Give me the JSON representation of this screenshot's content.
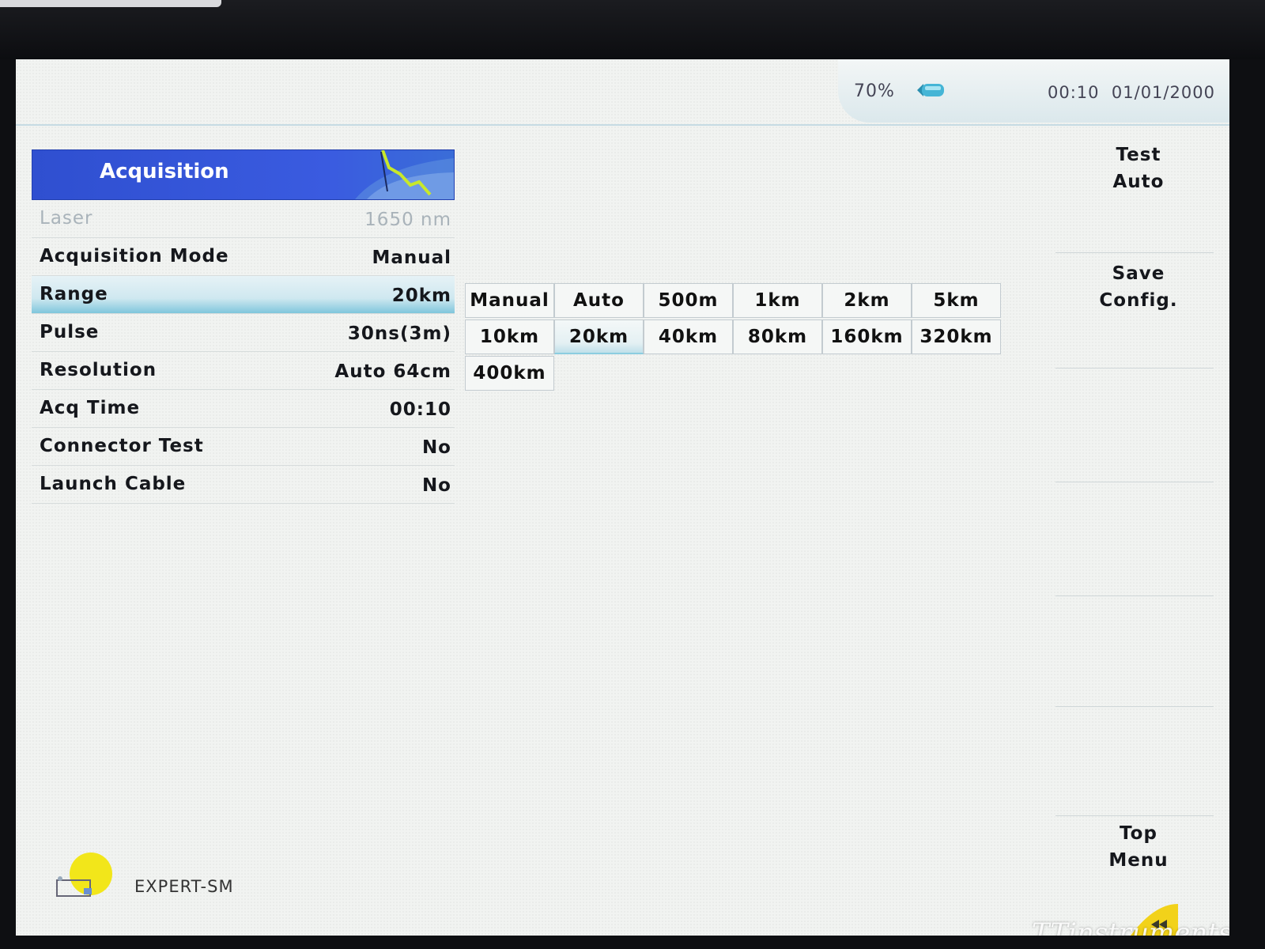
{
  "status": {
    "battery": "70%",
    "time": "00:10",
    "date": "01/01/2000"
  },
  "panel": {
    "title": "Acquisition",
    "rows": [
      {
        "label": "Laser",
        "value": "1650 nm"
      },
      {
        "label": "Acquisition Mode",
        "value": "Manual"
      },
      {
        "label": "Range",
        "value": "20km"
      },
      {
        "label": "Pulse",
        "value": "30ns(3m)"
      },
      {
        "label": "Resolution",
        "value": "Auto 64cm"
      },
      {
        "label": "Acq Time",
        "value": "00:10"
      },
      {
        "label": "Connector Test",
        "value": "No"
      },
      {
        "label": "Launch Cable",
        "value": "No"
      }
    ]
  },
  "range_options": [
    "Manual",
    "Auto",
    "500m",
    "1km",
    "2km",
    "5km",
    "10km",
    "20km",
    "40km",
    "80km",
    "160km",
    "320km",
    "400km"
  ],
  "softkeys": {
    "test_line1": "Test",
    "test_line2": "Auto",
    "save_line1": "Save",
    "save_line2": "Config.",
    "top_line1": "Top",
    "top_line2": "Menu"
  },
  "footer": {
    "mode": "EXPERT-SM",
    "watermark": "TTinstruments"
  },
  "colors": {
    "header_blue": "#3a5be0",
    "selection_cyan": "#7fc6dc",
    "indicator_yellow": "#f2e61a"
  }
}
